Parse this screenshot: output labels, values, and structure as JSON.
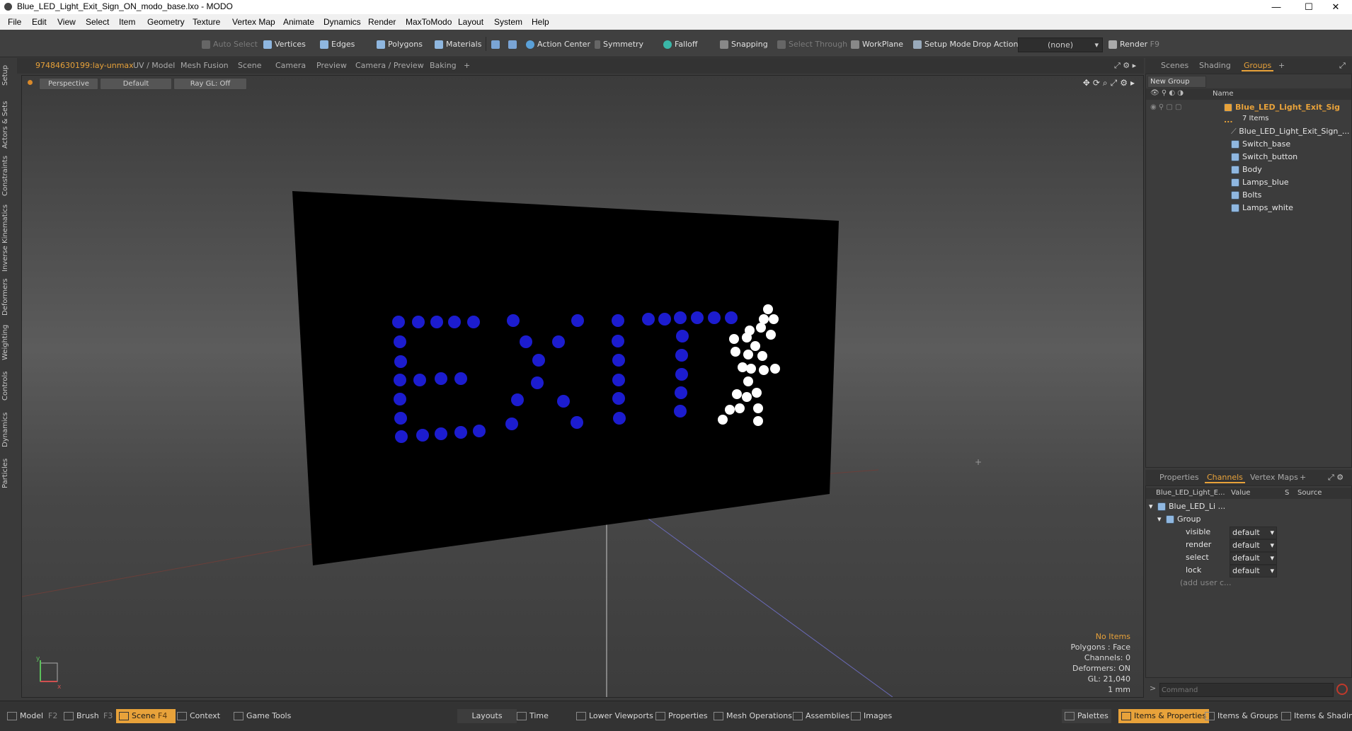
{
  "window": {
    "title": "Blue_LED_Light_Exit_Sign_ON_modo_base.lxo - MODO",
    "minimize": "—",
    "maximize": "☐",
    "close": "✕"
  },
  "menu": [
    "File",
    "Edit",
    "View",
    "Select",
    "Item",
    "Geometry",
    "Texture",
    "Vertex Map",
    "Animate",
    "Dynamics",
    "Render",
    "MaxToModo",
    "Layout",
    "System",
    "Help"
  ],
  "toolbar": {
    "auto_select": "Auto Select",
    "vertices": "Vertices",
    "edges": "Edges",
    "polygons": "Polygons",
    "materials": "Materials",
    "action_center": "Action Center",
    "symmetry": "Symmetry",
    "falloff": "Falloff",
    "snapping": "Snapping",
    "select_through": "Select Through",
    "workplane": "WorkPlane",
    "setup_mode": "Setup Mode",
    "drop_action": "Drop Action",
    "drop_value": "(none)",
    "render": "Render",
    "render_key": "F9"
  },
  "left_tabs": [
    "Setup",
    "Actors & Sets",
    "Constraints",
    "Inverse Kinematics",
    "Deformers",
    "Weighting",
    "Controls",
    "Dynamics",
    "Particles"
  ],
  "viewport_tabs": [
    "97484630199:lay-unmax",
    "UV / Model",
    "Mesh Fusion",
    "Scene",
    "Camera",
    "Preview",
    "Camera / Preview",
    "Baking",
    "+"
  ],
  "viewport": {
    "perspective": "Perspective",
    "default": "Default",
    "raygl": "Ray GL: Off",
    "info": {
      "items": "No Items",
      "polygons": "Polygons : Face",
      "channels": "Channels: 0",
      "deformers": "Deformers: ON",
      "gl": "GL: 21,040",
      "scale": "1 mm"
    }
  },
  "right_tabs_top": [
    "Scenes",
    "Shading",
    "Groups",
    "+"
  ],
  "groups": {
    "new_group": "New Group",
    "name_header": "Name",
    "group_name": "Blue_LED_Light_Exit_Sig ...",
    "items_count": "7 Items",
    "items": [
      "Blue_LED_Light_Exit_Sign_...",
      "Switch_base",
      "Switch_button",
      "Body",
      "Lamps_blue",
      "Bolts",
      "Lamps_white"
    ]
  },
  "right_tabs_bottom": [
    "Properties",
    "Channels",
    "Vertex Maps",
    "+"
  ],
  "channels": {
    "headers": [
      "Blue_LED_Light_E...",
      "Value",
      "S",
      "Source"
    ],
    "root": "Blue_LED_Li ...",
    "group": "Group",
    "rows": [
      {
        "name": "visible",
        "value": "default"
      },
      {
        "name": "render",
        "value": "default"
      },
      {
        "name": "select",
        "value": "default"
      },
      {
        "name": "lock",
        "value": "default"
      }
    ],
    "add_user": "(add user c..."
  },
  "command": {
    "placeholder": "Command"
  },
  "bottom": {
    "model": "Model",
    "model_key": "F2",
    "brush": "Brush",
    "brush_key": "F3",
    "scene": "Scene",
    "scene_key": "F4",
    "context": "Context",
    "game_tools": "Game Tools",
    "layouts": "Layouts",
    "time": "Time",
    "lower_viewports": "Lower Viewports",
    "properties": "Properties",
    "mesh_operations": "Mesh Operations",
    "assemblies": "Assemblies",
    "images": "Images",
    "palettes": "Palettes",
    "items_properties": "Items & Properties",
    "items_groups": "Items & Groups",
    "items_shading": "Items & Shading"
  },
  "colors": {
    "accent": "#e8a23a",
    "led_blue": "#1c1ccf",
    "led_white": "#ffffff"
  }
}
